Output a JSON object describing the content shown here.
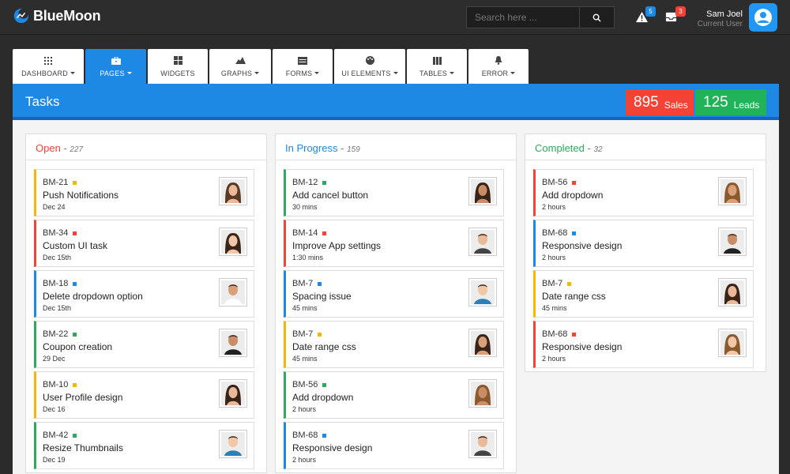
{
  "app": {
    "name": "BlueMoon"
  },
  "search": {
    "placeholder": "Search here ..."
  },
  "notifications": {
    "alerts_count": "5",
    "messages_count": "3"
  },
  "user": {
    "name": "Sam Joel",
    "role": "Current User"
  },
  "nav": [
    {
      "label": "DASHBOARD",
      "icon": "dashboard-icon",
      "active": false
    },
    {
      "label": "PAGES",
      "icon": "briefcase-icon",
      "active": true
    },
    {
      "label": "WIDGETS",
      "icon": "widgets-grid-icon",
      "active": false
    },
    {
      "label": "GRAPHS",
      "icon": "mountain-chart-icon",
      "active": false
    },
    {
      "label": "FORMS",
      "icon": "form-icon",
      "active": false
    },
    {
      "label": "UI ELEMENTS",
      "icon": "palette-icon",
      "active": false
    },
    {
      "label": "TABLES",
      "icon": "table-columns-icon",
      "active": false
    },
    {
      "label": "ERROR",
      "icon": "bell-icon",
      "active": false
    }
  ],
  "page": {
    "title": "Tasks"
  },
  "stats": {
    "sales": {
      "value": "895",
      "label": "Sales",
      "color": "#f44336"
    },
    "leads": {
      "value": "125",
      "label": "Leads",
      "color": "#21b35a"
    }
  },
  "colors": {
    "accent": "#1e88e5",
    "red": "#f44336",
    "green": "#2eab5a",
    "blue": "#1e88e5",
    "yellow": "#f5b800"
  },
  "columns": [
    {
      "title": "Open",
      "count": "227",
      "color": "#f44336",
      "cards": [
        {
          "id": "BM-21",
          "title": "Push Notifications",
          "meta": "Dec 24",
          "color": "#f5b800",
          "avatar": "female"
        },
        {
          "id": "BM-34",
          "title": "Custom UI task",
          "meta": "Dec 15th",
          "color": "#f44336",
          "avatar": "female"
        },
        {
          "id": "BM-18",
          "title": "Delete dropdown option",
          "meta": "Dec 15th",
          "color": "#1e88e5",
          "avatar": "male"
        },
        {
          "id": "BM-22",
          "title": "Coupon creation",
          "meta": "29 Dec",
          "color": "#2eab5a",
          "avatar": "male"
        },
        {
          "id": "BM-10",
          "title": "User Profile design",
          "meta": "Dec 16",
          "color": "#f5b800",
          "avatar": "female"
        },
        {
          "id": "BM-42",
          "title": "Resize Thumbnails",
          "meta": "Dec 19",
          "color": "#2eab5a",
          "avatar": "male"
        }
      ]
    },
    {
      "title": "In Progress",
      "count": "159",
      "color": "#1e88e5",
      "cards": [
        {
          "id": "BM-12",
          "title": "Add cancel button",
          "meta": "30 mins",
          "color": "#2eab5a",
          "avatar": "female"
        },
        {
          "id": "BM-14",
          "title": "Improve App settings",
          "meta": "1:30 mins",
          "color": "#f44336",
          "avatar": "male"
        },
        {
          "id": "BM-7",
          "title": "Spacing issue",
          "meta": "45 mins",
          "color": "#1e88e5",
          "avatar": "male"
        },
        {
          "id": "BM-7",
          "title": "Date range css",
          "meta": "45 mins",
          "color": "#f5b800",
          "avatar": "female"
        },
        {
          "id": "BM-56",
          "title": "Add dropdown",
          "meta": "2 hours",
          "color": "#2eab5a",
          "avatar": "female"
        },
        {
          "id": "BM-68",
          "title": "Responsive design",
          "meta": "2 hours",
          "color": "#1e88e5",
          "avatar": "male"
        }
      ]
    },
    {
      "title": "Completed",
      "count": "32",
      "color": "#2eab5a",
      "cards": [
        {
          "id": "BM-56",
          "title": "Add dropdown",
          "meta": "2 hours",
          "color": "#f44336",
          "avatar": "female"
        },
        {
          "id": "BM-68",
          "title": "Responsive design",
          "meta": "2 hours",
          "color": "#1e88e5",
          "avatar": "male"
        },
        {
          "id": "BM-7",
          "title": "Date range css",
          "meta": "45 mins",
          "color": "#f5b800",
          "avatar": "female"
        },
        {
          "id": "BM-68",
          "title": "Responsive design",
          "meta": "2 hours",
          "color": "#f44336",
          "avatar": "female"
        }
      ]
    }
  ]
}
